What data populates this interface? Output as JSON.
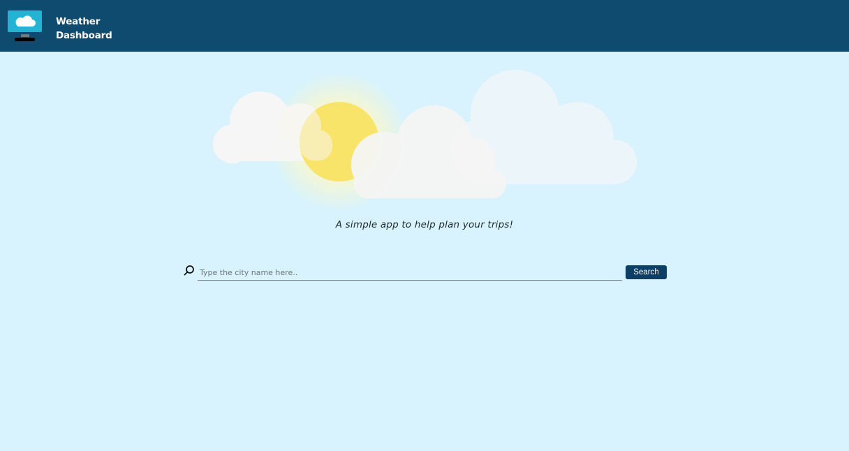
{
  "header": {
    "logo_icon": "cloud-monitor-icon",
    "title_line1": "Weather",
    "title_line2": "Dashboard"
  },
  "hero": {
    "illustration": "sun-and-clouds"
  },
  "tagline": "A simple app to help plan your trips!",
  "search": {
    "icon": "search-icon",
    "placeholder": "Type the city name here..",
    "value": "",
    "button_label": "Search"
  },
  "colors": {
    "header_bg": "#0f4a6f",
    "page_bg": "#d8f3fd",
    "button_bg": "#0d3f66",
    "sun": "#f9e46a"
  }
}
